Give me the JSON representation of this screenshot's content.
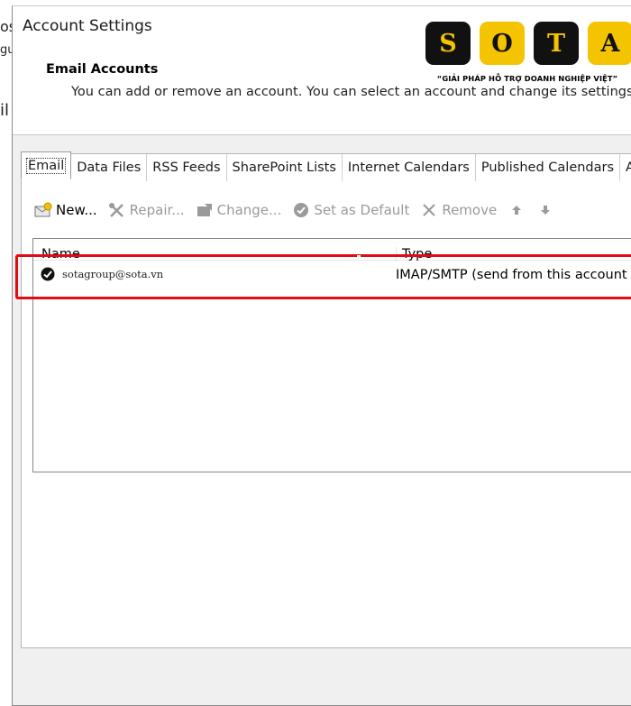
{
  "background": {
    "fragment_1": "os",
    "fragment_2": "gu",
    "fragment_3": "il"
  },
  "dialog": {
    "title": "Account Settings",
    "section_heading": "Email Accounts",
    "section_description": "You can add or remove an account. You can select an account and change its settings."
  },
  "logo": {
    "letters": [
      "S",
      "O",
      "T",
      "A"
    ],
    "slogan": "“GIẢI PHÁP HỖ TRỢ DOANH NGHIỆP VIỆT”"
  },
  "tabs": [
    {
      "label": "Email",
      "active": true
    },
    {
      "label": "Data Files"
    },
    {
      "label": "RSS Feeds"
    },
    {
      "label": "SharePoint Lists"
    },
    {
      "label": "Internet Calendars"
    },
    {
      "label": "Published Calendars"
    },
    {
      "label": "A"
    }
  ],
  "toolbar": {
    "new_label": "New...",
    "repair_label": "Repair...",
    "change_label": "Change...",
    "set_default_label": "Set as Default",
    "remove_label": "Remove"
  },
  "accounts": {
    "columns": {
      "name": "Name",
      "type": "Type"
    },
    "rows": [
      {
        "name": "sotagroup@sota.vn",
        "type": "IMAP/SMTP (send from this account b"
      }
    ]
  },
  "colors": {
    "highlight": "#e00b13",
    "logo_yellow": "#f4c400",
    "logo_dark": "#111111"
  }
}
